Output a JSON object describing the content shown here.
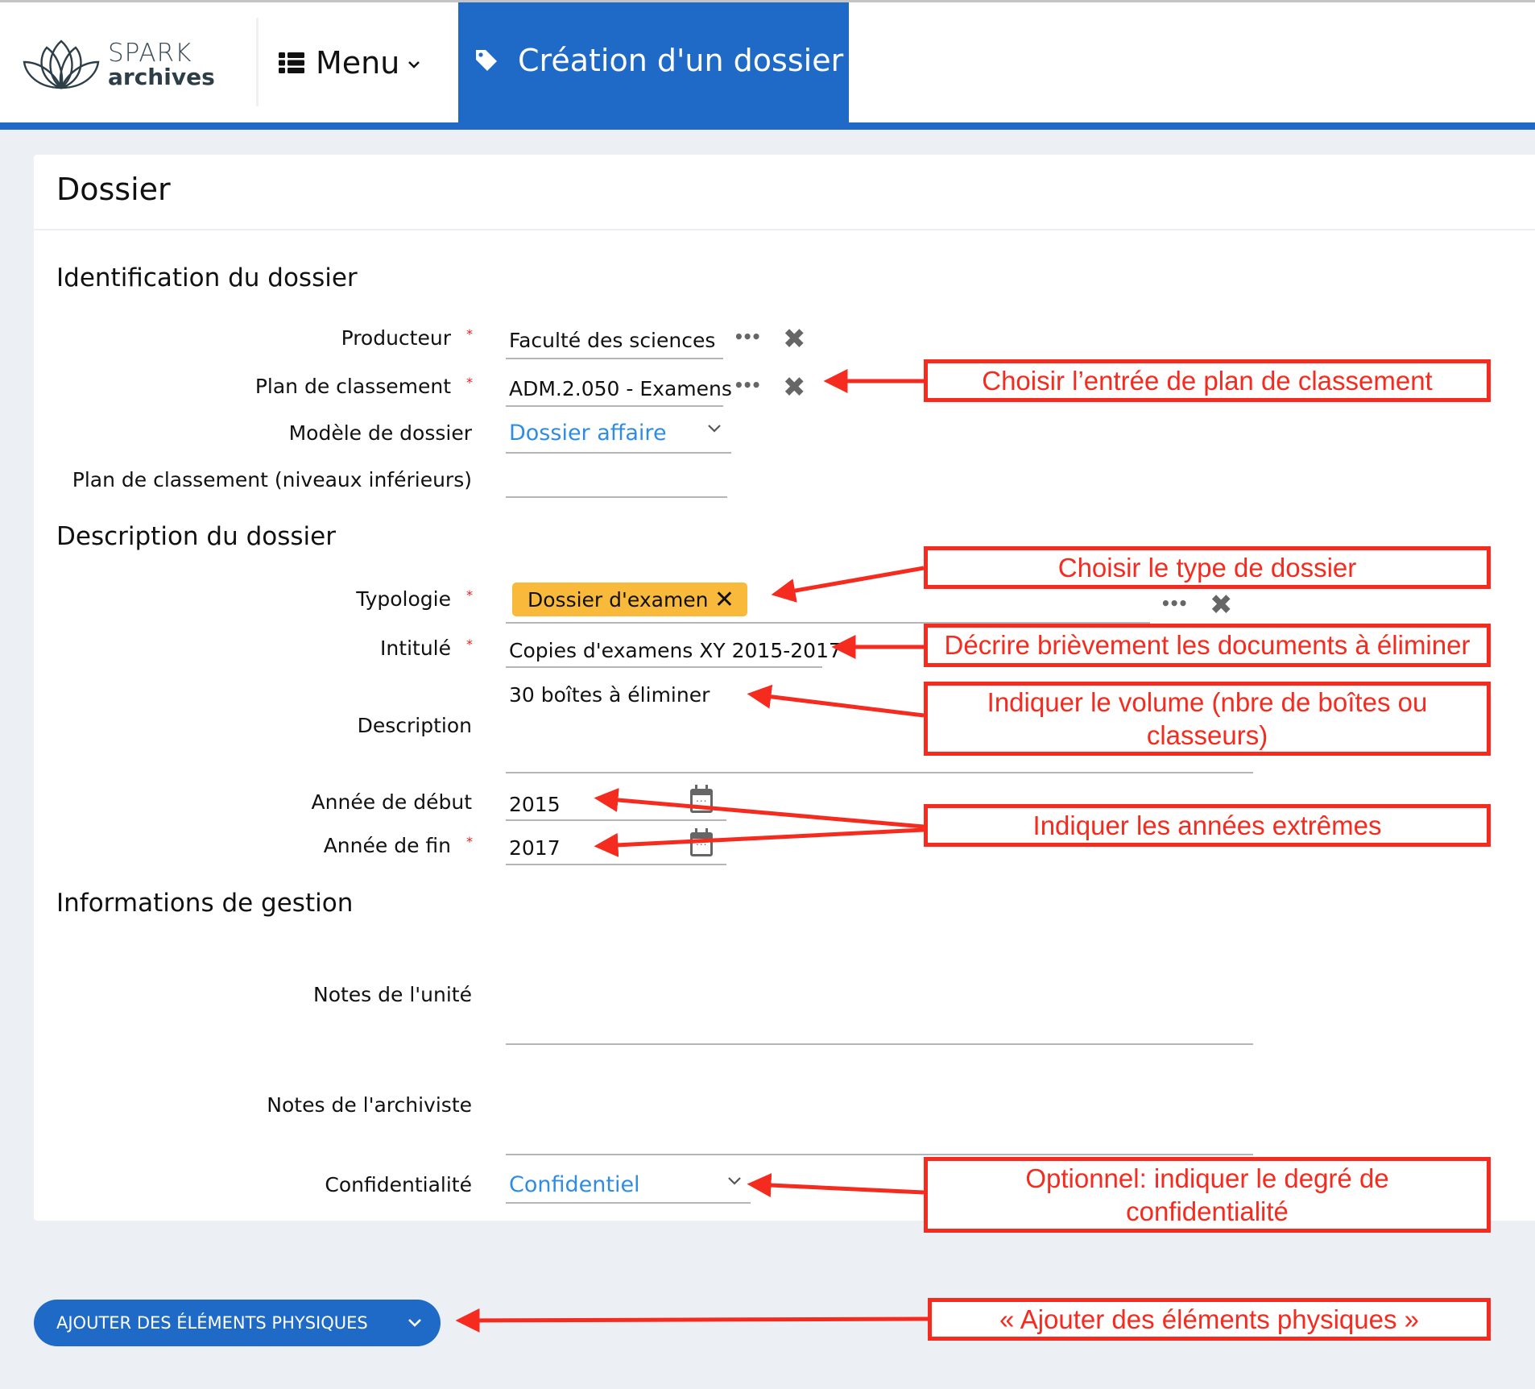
{
  "header": {
    "logo": {
      "line1": "SPARK",
      "line2": "archives",
      "icon": "lotus-logo-icon"
    },
    "menu": {
      "label": "Menu",
      "icon": "list-icon",
      "chevron": "chevron-down-icon"
    },
    "active_tab": {
      "label": "Création d'un dossier",
      "icon": "tag-icon"
    },
    "accent_color": "#1F6AC6"
  },
  "card": {
    "title": "Dossier",
    "sections": {
      "identification": "Identification du dossier",
      "description": "Description du dossier",
      "gestion": "Informations de gestion"
    }
  },
  "fields": {
    "producteur": {
      "label": "Producteur",
      "required": true,
      "value": "Faculté des sciences"
    },
    "plan_classement": {
      "label": "Plan de classement",
      "required": true,
      "value": "ADM.2.050 - Examens"
    },
    "modele": {
      "label": "Modèle de dossier",
      "value": "Dossier affaire"
    },
    "plan_niveaux": {
      "label": "Plan de classement (niveaux inférieurs)",
      "value": ""
    },
    "typologie": {
      "label": "Typologie",
      "required": true,
      "chip": "Dossier d'examen",
      "chip_color": "#F9B93B"
    },
    "intitule": {
      "label": "Intitulé",
      "required": true,
      "value": "Copies d'examens XY 2015-2017"
    },
    "description": {
      "label": "Description",
      "value": "30 boîtes à éliminer"
    },
    "annee_debut": {
      "label": "Année de début",
      "value": "2015"
    },
    "annee_fin": {
      "label": "Année de fin",
      "required": true,
      "value": "2017"
    },
    "notes_unite": {
      "label": "Notes de l'unité",
      "value": ""
    },
    "notes_archiviste": {
      "label": "Notes de l'archiviste",
      "value": ""
    },
    "confidentialite": {
      "label": "Confidentialité",
      "value": "Confidentiel"
    }
  },
  "common": {
    "required_mark": "*",
    "more_glyph": "•••",
    "clear_glyph": "✖",
    "chevron_glyph": "⌄",
    "chip_remove_glyph": "✕"
  },
  "add_button": {
    "label": "AJOUTER DES ÉLÉMENTS PHYSIQUES",
    "icon": "chevron-down-icon"
  },
  "annotations": {
    "color": "#F42B1E",
    "items": [
      "Choisir l’entrée de plan de classement",
      "Choisir le type de dossier",
      "Décrire brièvement les documents à éliminer",
      "Indiquer le volume (nbre de boîtes ou classeurs)",
      "Indiquer les années extrêmes",
      "Optionnel: indiquer le degré de confidentialité",
      "« Ajouter des éléments physiques »"
    ]
  }
}
